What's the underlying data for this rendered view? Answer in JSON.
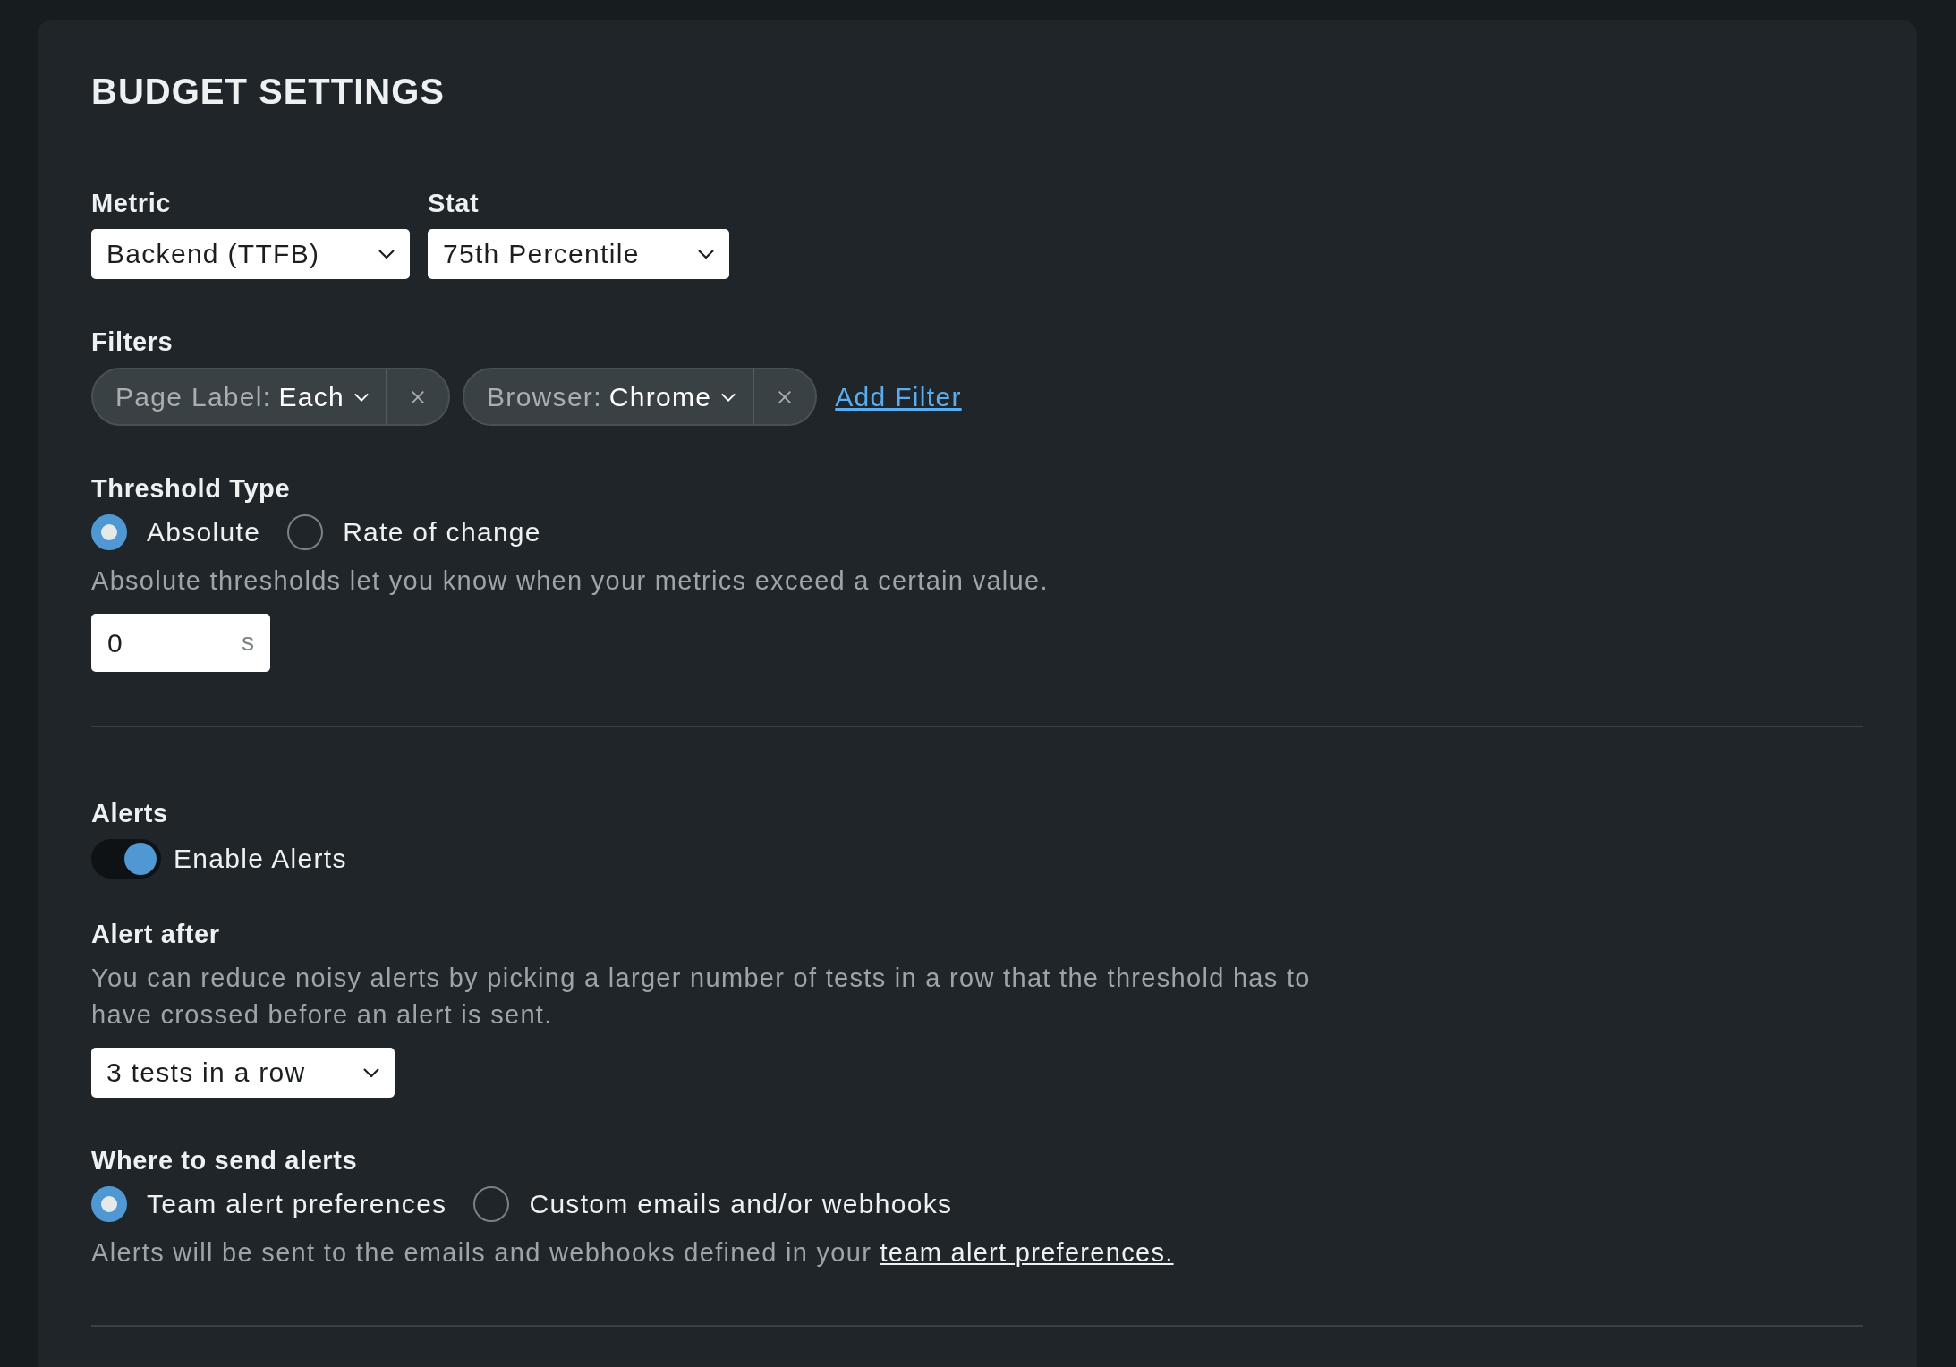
{
  "title": "BUDGET SETTINGS",
  "selects": [
    {
      "label": "Metric",
      "value": "Backend (TTFB)"
    },
    {
      "label": "Stat",
      "value": "75th Percentile"
    }
  ],
  "filters": {
    "label": "Filters",
    "items": [
      {
        "key": "Page Label:",
        "value": "Each"
      },
      {
        "key": "Browser:",
        "value": "Chrome"
      }
    ],
    "add_link": "Add Filter"
  },
  "threshold_type": {
    "label": "Threshold Type",
    "options": [
      {
        "label": "Absolute",
        "selected": true
      },
      {
        "label": "Rate of change",
        "selected": false
      }
    ],
    "help": "Absolute thresholds let you know when your metrics exceed a certain value.",
    "input": {
      "value": "0",
      "unit": "s"
    }
  },
  "alerts": {
    "label": "Alerts",
    "toggle": {
      "label": "Enable Alerts",
      "on": true
    }
  },
  "alert_after": {
    "label": "Alert after",
    "help": "You can reduce noisy alerts by picking a larger number of tests in a row that the threshold has to have crossed before an alert is sent.",
    "value": "3 tests in a row"
  },
  "send_to": {
    "label": "Where to send alerts",
    "options": [
      {
        "label": "Team alert preferences",
        "selected": true
      },
      {
        "label": "Custom emails and/or webhooks",
        "selected": false
      }
    ],
    "help": "Alerts will be sent to the emails and webhooks defined in your ",
    "link": "team alert preferences."
  }
}
